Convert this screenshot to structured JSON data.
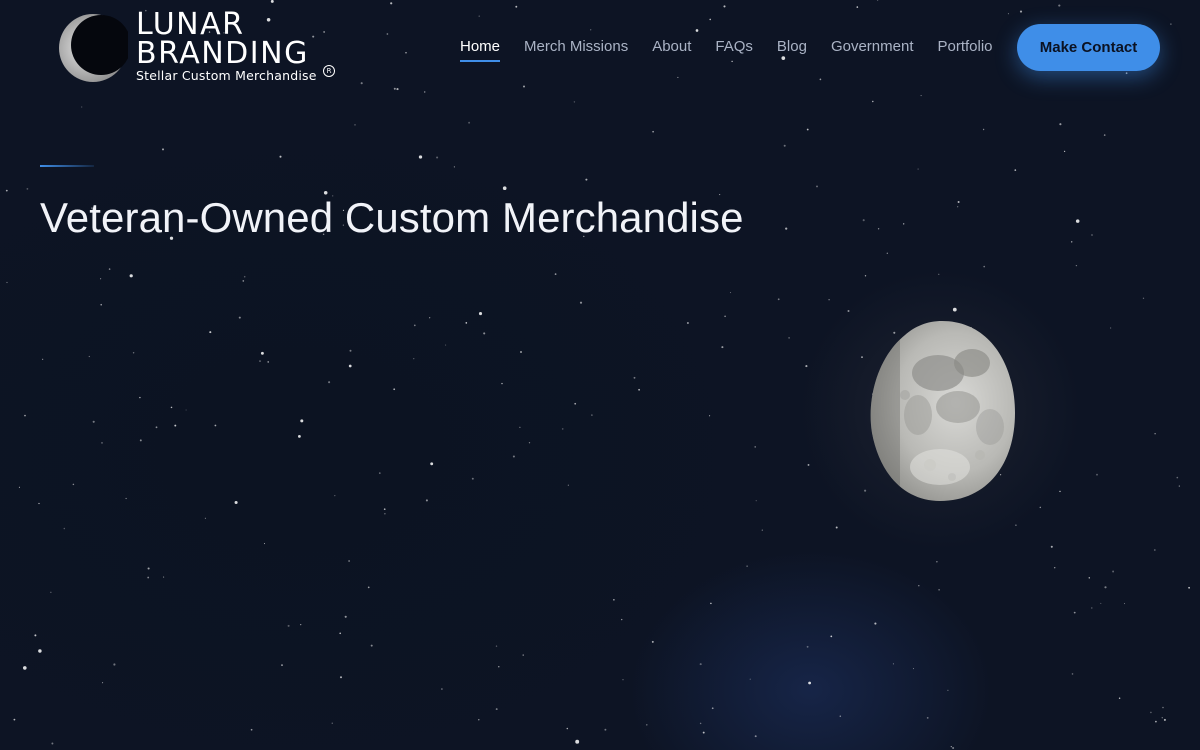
{
  "brand": {
    "line1": "LUNAR",
    "line2": "BRANDING",
    "tagline": "Stellar Custom Merchandise",
    "registered": "R"
  },
  "nav": {
    "items": [
      {
        "label": "Home",
        "active": true
      },
      {
        "label": "Merch Missions",
        "active": false
      },
      {
        "label": "About",
        "active": false
      },
      {
        "label": "FAQs",
        "active": false
      },
      {
        "label": "Blog",
        "active": false
      },
      {
        "label": "Government",
        "active": false
      },
      {
        "label": "Portfolio",
        "active": false
      }
    ],
    "cta_label": "Make Contact"
  },
  "hero": {
    "title": "Veteran-Owned Custom Merchandise"
  },
  "colors": {
    "background": "#0d1424",
    "accent": "#3f8ee8",
    "text": "#f1f3f8",
    "nav_text": "#aab3c5"
  }
}
